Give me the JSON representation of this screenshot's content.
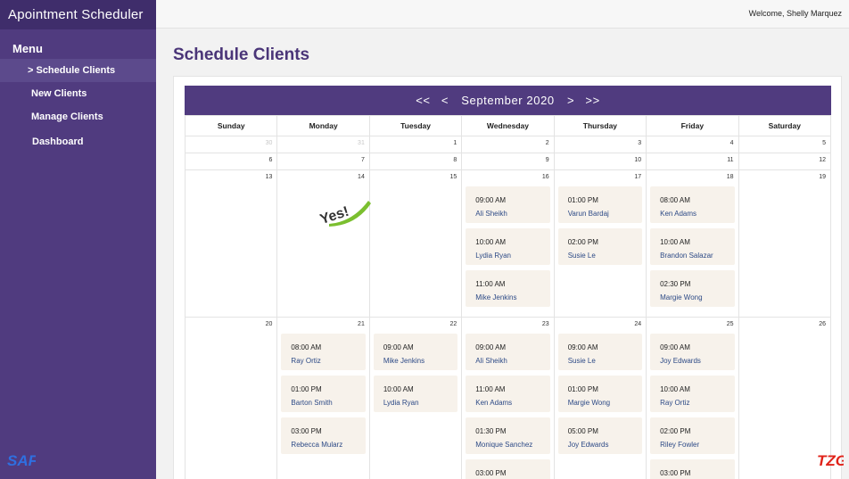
{
  "app": {
    "title": "Apointment Scheduler"
  },
  "sidebar": {
    "menu_heading": "Menu",
    "items": [
      {
        "label": "> Schedule Clients"
      },
      {
        "label": "New Clients"
      },
      {
        "label": "Manage Clients"
      },
      {
        "label": "Dashboard"
      }
    ],
    "logo_text": "SAF"
  },
  "header": {
    "welcome": "Welcome, Shelly Marquez"
  },
  "page": {
    "title": "Schedule Clients"
  },
  "calendar": {
    "nav": {
      "prev_year": "<<",
      "prev_month": "<",
      "month_label": "September 2020",
      "next_month": ">",
      "next_year": ">>"
    },
    "weekdays": [
      "Sunday",
      "Monday",
      "Tuesday",
      "Wednesday",
      "Thursday",
      "Friday",
      "Saturday"
    ],
    "weeks": [
      [
        {
          "d": "30",
          "other": true
        },
        {
          "d": "31",
          "other": true
        },
        {
          "d": "1"
        },
        {
          "d": "2"
        },
        {
          "d": "3"
        },
        {
          "d": "4"
        },
        {
          "d": "5"
        }
      ],
      [
        {
          "d": "6"
        },
        {
          "d": "7"
        },
        {
          "d": "8"
        },
        {
          "d": "9"
        },
        {
          "d": "10"
        },
        {
          "d": "11"
        },
        {
          "d": "12"
        }
      ],
      [
        {
          "d": "13"
        },
        {
          "d": "14"
        },
        {
          "d": "15"
        },
        {
          "d": "16",
          "appts": [
            {
              "time": "09:00 AM",
              "client": "Ali Sheikh"
            },
            {
              "time": "10:00 AM",
              "client": "Lydia Ryan"
            },
            {
              "time": "11:00 AM",
              "client": "Mike Jenkins"
            }
          ]
        },
        {
          "d": "17",
          "appts": [
            {
              "time": "01:00 PM",
              "client": "Varun Bardaj"
            },
            {
              "time": "02:00 PM",
              "client": "Susie Le"
            }
          ]
        },
        {
          "d": "18",
          "appts": [
            {
              "time": "08:00 AM",
              "client": "Ken Adams"
            },
            {
              "time": "10:00 AM",
              "client": "Brandon Salazar"
            },
            {
              "time": "02:30 PM",
              "client": "Margie Wong"
            }
          ]
        },
        {
          "d": "19"
        }
      ],
      [
        {
          "d": "20"
        },
        {
          "d": "21",
          "appts": [
            {
              "time": "08:00 AM",
              "client": "Ray Ortiz"
            },
            {
              "time": "01:00 PM",
              "client": "Barton Smith"
            },
            {
              "time": "03:00 PM",
              "client": "Rebecca Mularz"
            }
          ]
        },
        {
          "d": "22",
          "appts": [
            {
              "time": "09:00 AM",
              "client": "Mike Jenkins"
            },
            {
              "time": "10:00 AM",
              "client": "Lydia Ryan"
            }
          ]
        },
        {
          "d": "23",
          "appts": [
            {
              "time": "09:00 AM",
              "client": "Ali Sheikh"
            },
            {
              "time": "11:00 AM",
              "client": "Ken Adams"
            },
            {
              "time": "01:30 PM",
              "client": "Monique Sanchez"
            },
            {
              "time": "03:00 PM",
              "client": ""
            }
          ]
        },
        {
          "d": "24",
          "appts": [
            {
              "time": "09:00 AM",
              "client": "Susie Le"
            },
            {
              "time": "01:00 PM",
              "client": "Margie Wong"
            },
            {
              "time": "05:00 PM",
              "client": "Joy Edwards"
            }
          ]
        },
        {
          "d": "25",
          "appts": [
            {
              "time": "09:00 AM",
              "client": "Joy Edwards"
            },
            {
              "time": "10:00 AM",
              "client": "Ray Ortiz"
            },
            {
              "time": "02:00 PM",
              "client": "Riley Fowler"
            },
            {
              "time": "03:00 PM",
              "client": ""
            }
          ]
        },
        {
          "d": "26"
        }
      ]
    ]
  },
  "sticker": {
    "text": "Yes!"
  },
  "watermark": {
    "text": "TZG"
  },
  "colors": {
    "sidebar": "#503b7f",
    "sidebar_title": "#3f2d6b",
    "title": "#4a3578",
    "appt_bg": "#f7f2eb",
    "client": "#2d4a86"
  }
}
